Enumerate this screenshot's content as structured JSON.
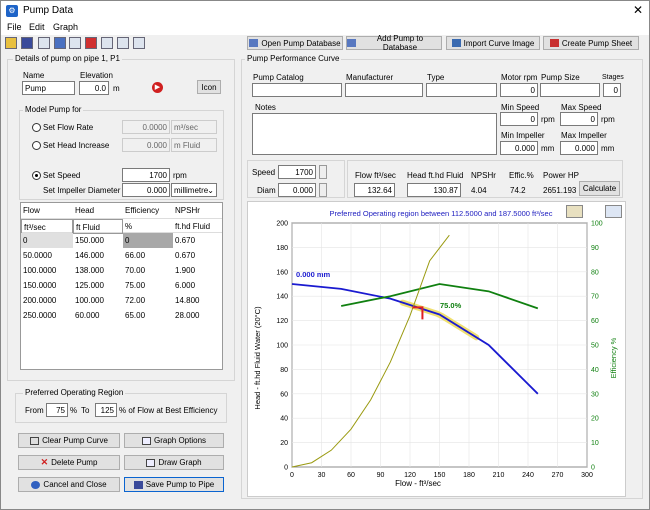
{
  "window": {
    "title": "Pump Data"
  },
  "menu": [
    "File",
    "Edit",
    "Graph"
  ],
  "top_buttons": {
    "open_db": "Open Pump Database",
    "add_db": "Add Pump to Database",
    "import": "Import Curve Image",
    "sheet": "Create Pump Sheet"
  },
  "details": {
    "group_title": "Details of pump on pipe 1, P1",
    "name_label": "Name",
    "name_value": "Pump",
    "elev_label": "Elevation",
    "elev_value": "0.0",
    "elev_unit": "m",
    "icon_btn": "Icon"
  },
  "model": {
    "group_title": "Model Pump for",
    "flow_rate_label": "Set Flow Rate",
    "flow_rate_value": "0.0000",
    "flow_rate_unit": "m³/sec",
    "head_label": "Set Head Increase",
    "head_value": "0.000",
    "head_unit": "m Fluid",
    "speed_label": "Set Speed",
    "speed_value": "1700",
    "speed_unit": "rpm",
    "impeller_label": "Set Impeller Diameter",
    "impeller_value": "0.000",
    "impeller_unit": "millimetre"
  },
  "table": {
    "headers": [
      "Flow",
      "Head",
      "Efficiency",
      "NPSHr"
    ],
    "units": [
      "ft³/sec",
      "ft Fluid",
      "%",
      "ft.hd Fluid"
    ],
    "rows": [
      [
        "0",
        "150.000",
        "0",
        "0.670"
      ],
      [
        "50.0000",
        "146.000",
        "66.00",
        "0.670"
      ],
      [
        "100.0000",
        "138.000",
        "70.00",
        "1.900"
      ],
      [
        "150.0000",
        "125.000",
        "75.00",
        "6.000"
      ],
      [
        "200.0000",
        "100.000",
        "72.00",
        "14.800"
      ],
      [
        "250.0000",
        "60.000",
        "65.00",
        "28.000"
      ]
    ]
  },
  "por": {
    "group_title": "Preferred Operating Region",
    "from_label": "From",
    "from_value": "75",
    "pct": "%",
    "to_label": "To",
    "to_value": "125",
    "suffix": "% of Flow at Best Efficiency"
  },
  "bottom_buttons": {
    "clear": "Clear Pump Curve",
    "graph_opts": "Graph Options",
    "delete": "Delete Pump",
    "draw": "Draw Graph",
    "cancel": "Cancel and Close",
    "save": "Save Pump to Pipe"
  },
  "perf": {
    "group_title": "Pump Performance Curve",
    "catalog": "Pump Catalog",
    "manufacturer": "Manufacturer",
    "type": "Type",
    "notes": "Notes",
    "motor_rpm": "Motor rpm",
    "motor_rpm_value": "0",
    "pump_size": "Pump Size",
    "stages": "Stages",
    "stages_value": "0",
    "min_speed": "Min Speed",
    "min_speed_value": "0",
    "min_speed_unit": "rpm",
    "max_speed": "Max Speed",
    "max_speed_value": "0",
    "max_speed_unit": "rpm",
    "min_imp": "Min Impeller",
    "min_imp_value": "0.000",
    "min_imp_unit": "mm",
    "max_imp": "Max Impeller",
    "max_imp_value": "0.000",
    "max_imp_unit": "mm"
  },
  "op": {
    "speed_label": "Speed",
    "speed_value": "1700",
    "diam_label": "Diam",
    "diam_value": "0.000",
    "flow_h": "Flow ft³/sec",
    "head_h": "Head ft.hd Fluid",
    "npshr_h": "NPSHr",
    "eff_h": "Effic.%",
    "power_h": "Power HP",
    "flow_v": "132.64",
    "head_v": "130.87",
    "npshr_v": "4.04",
    "eff_v": "74.2",
    "power_v": "2651.193",
    "calc": "Calculate"
  },
  "chart_data": {
    "type": "line",
    "title": "Preferred Operating region between 112.5000 and 187.5000 ft³/sec",
    "xlabel": "Flow - ft³/sec",
    "ylabel": "Head - ft.hd Fluid Water (20°C)",
    "y2label": "Efficiency %",
    "xlim": [
      0,
      300
    ],
    "ylim": [
      0,
      200
    ],
    "y2lim": [
      0,
      100
    ],
    "xticks": [
      0,
      30,
      60,
      90,
      120,
      150,
      180,
      210,
      240,
      270,
      300
    ],
    "yticks": [
      0,
      20,
      40,
      60,
      80,
      100,
      120,
      140,
      160,
      180,
      200
    ],
    "y2ticks": [
      0,
      10,
      20,
      30,
      40,
      50,
      60,
      70,
      80,
      90,
      100
    ],
    "curve_label": "0.000 mm",
    "eff_label": "75.0%",
    "series": [
      {
        "color": "#1a1ad0",
        "axis": "y",
        "x": [
          0,
          50,
          100,
          150,
          200,
          250
        ],
        "y": [
          150,
          146,
          138,
          125,
          100,
          60
        ]
      },
      {
        "color": "#108010",
        "axis": "y2",
        "x": [
          50,
          100,
          150,
          200,
          250
        ],
        "y": [
          66,
          70,
          75,
          72,
          65
        ]
      },
      {
        "color": "#9a9a10",
        "axis": "y",
        "x": [
          0,
          20,
          40,
          60,
          80,
          100,
          120,
          140,
          160
        ],
        "y": [
          0,
          3.5,
          13.8,
          31,
          55,
          86,
          124,
          169,
          190
        ]
      }
    ],
    "por_band": [
      112.5,
      187.5
    ],
    "op_point": [
      132.64,
      130.87
    ]
  }
}
